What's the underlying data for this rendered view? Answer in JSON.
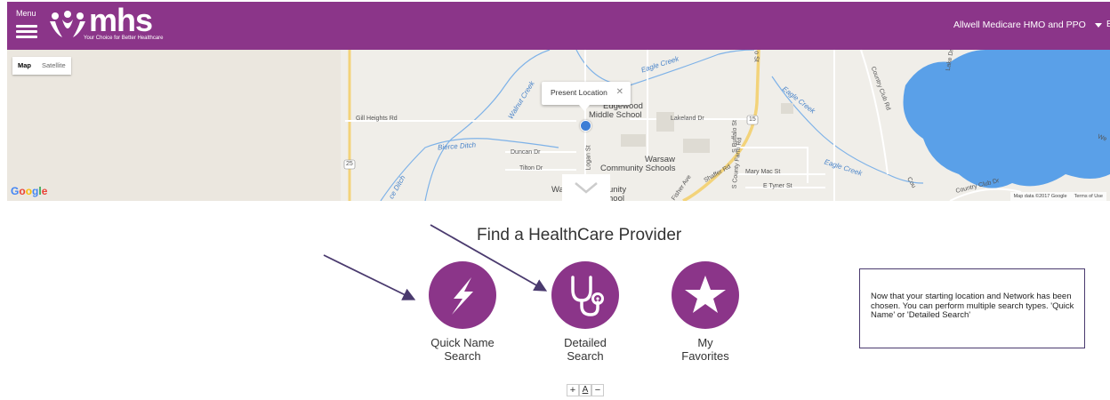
{
  "header": {
    "menu_label": "Menu",
    "logo_text": "mhs",
    "logo_tagline": "Your Choice for Better Healthcare",
    "plan_name": "Allwell Medicare HMO and PPO",
    "edge_glyph": "E"
  },
  "map": {
    "toggle": {
      "map": "Map",
      "satellite": "Satellite"
    },
    "popup": {
      "text": "Present Location",
      "close": "✕"
    },
    "labels": {
      "eagle_creek_1": "Eagle Creek",
      "eagle_creek_2": "Eagle Creek",
      "eagle_creek_3": "Eagle Creek",
      "walnut_creek": "Walnut Creek",
      "bierce_ditch": "Bierce Ditch",
      "edgewood": "Edgewood",
      "middle_school": "Middle School",
      "warsaw": "Warsaw",
      "community_schools": "Community Schools",
      "gill_heights": "Gill Heights Rd",
      "duncan": "Duncan Dr",
      "tilton": "Tilton Dr",
      "logan": "Logan St",
      "lakeland": "Lakeland Dr",
      "s_buffalo": "S Buffalo St",
      "s_county_farm": "S County Farm Rd",
      "shaffer": "Shaffer Rd",
      "mary_mac": "Mary Mac St",
      "e_tyner": "E Tyner St",
      "fisher_ave": "Fisher Ave",
      "country_club_rd": "Country Club Rd",
      "country_club_dr": "Country Club Dr",
      "route_15": "15",
      "route_25": "25",
      "wa_partial": "Wa",
      "unity_partial": "unity",
      "school_partial": "hool",
      "ditch_partial": "ce Ditch",
      "q_st": "o St",
      "lake_dr": "Lake Dr",
      "cou_partial": "Cou",
      "we_partial": "We"
    },
    "footer": {
      "data": "Map data ©2017 Google",
      "terms": "Terms of Use"
    }
  },
  "main": {
    "title": "Find a HealthCare Provider",
    "tiles": [
      {
        "line1": "Quick Name",
        "line2": "Search"
      },
      {
        "line1": "Detailed",
        "line2": "Search"
      },
      {
        "line1": "My",
        "line2": "Favorites"
      }
    ],
    "font_controls": {
      "increase": "+",
      "reset": "A",
      "decrease": "−"
    }
  },
  "note": {
    "text": "Now that your starting location and Network has been chosen. You can perform multiple search types.  'Quick Name' or 'Detailed Search'"
  },
  "colors": {
    "brand_purple": "#8b3589",
    "map_background": "#ebe7df",
    "water": "#5aa0e8",
    "arrow": "#4a3a6e"
  }
}
